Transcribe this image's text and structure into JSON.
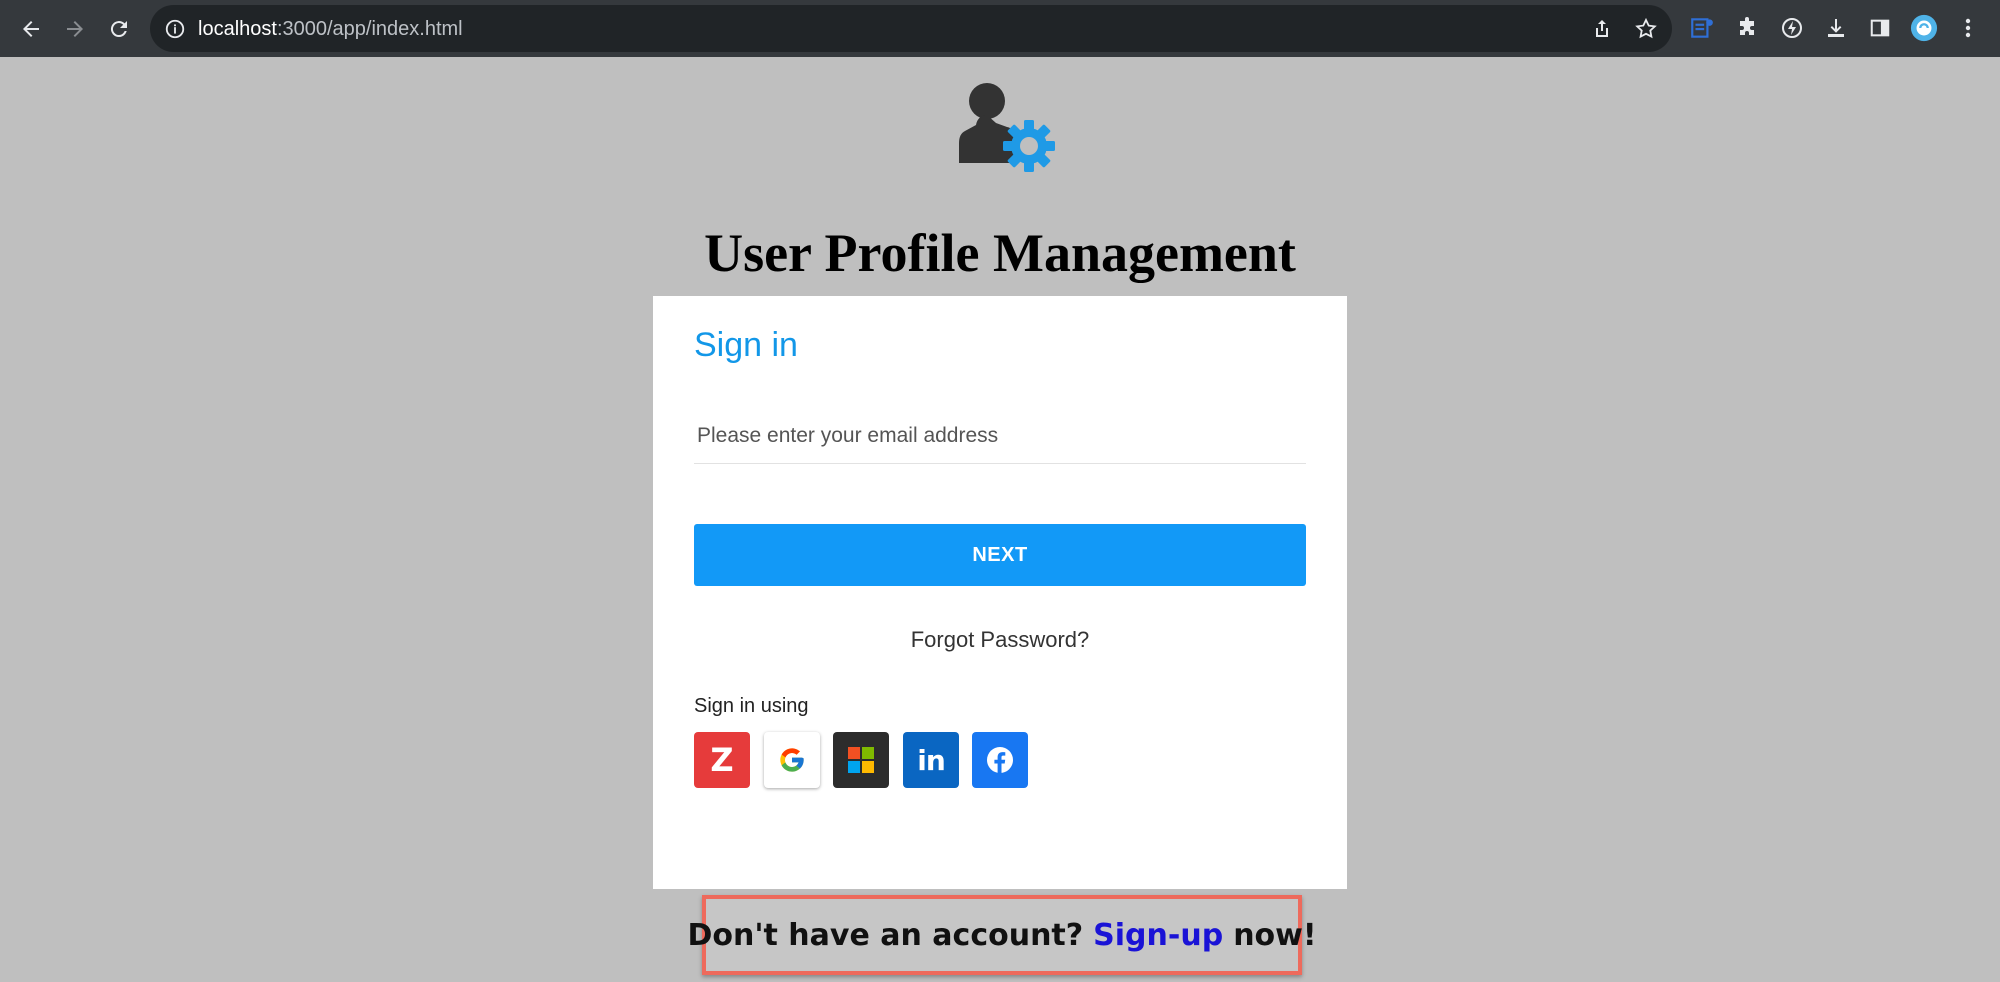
{
  "browser": {
    "url_host": "localhost",
    "url_path": ":3000/app/index.html"
  },
  "page": {
    "app_title": "User Profile Management"
  },
  "signin": {
    "heading": "Sign in",
    "email_placeholder": "Please enter your email address",
    "next_label": "NEXT",
    "forgot_label": "Forgot Password?",
    "signin_using_label": "Sign in using",
    "providers": [
      {
        "name": "Zoho",
        "letter": "Z"
      },
      {
        "name": "Google"
      },
      {
        "name": "Microsoft"
      },
      {
        "name": "LinkedIn",
        "letter": "in"
      },
      {
        "name": "Facebook"
      }
    ]
  },
  "signup": {
    "prefix": "Don't have an account?",
    "link": "Sign-up",
    "suffix": "now!"
  },
  "colors": {
    "accent": "#1299f7",
    "page_bg": "#bfbfbf",
    "highlight_border": "#ee6a5c"
  }
}
